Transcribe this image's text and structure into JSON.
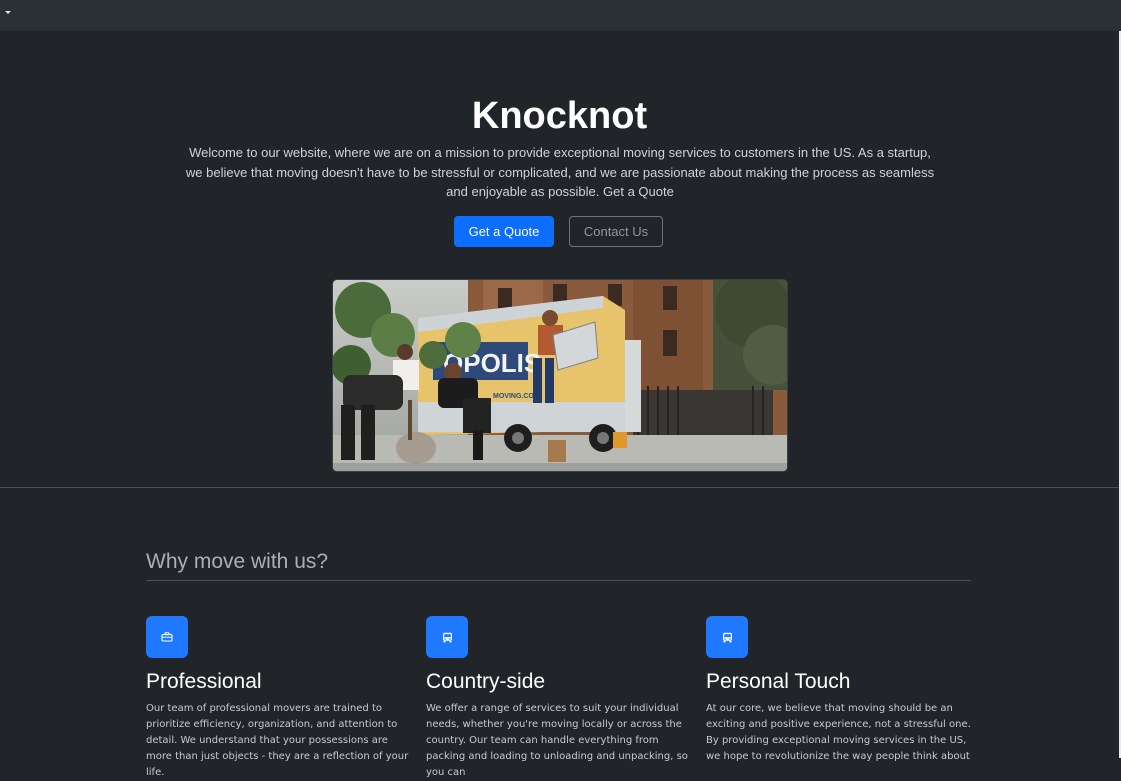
{
  "hero": {
    "title": "Knocknot",
    "intro": "Welcome to our website, where we are on a mission to provide exceptional moving services to customers in the US. As a startup, we believe that moving doesn't have to be stressful or complicated, and we are passionate about making the process as seamless and enjoyable as possible. Get a Quote",
    "primary_button": "Get a Quote",
    "secondary_button": "Contact Us",
    "image_truck_text": "OPOLIS",
    "image_truck_url_text": "MOVING.COM"
  },
  "why": {
    "title": "Why move with us?",
    "features": [
      {
        "icon": "briefcase-icon",
        "title": "Professional",
        "text": "Our team of professional movers are trained to prioritize efficiency, organization, and attention to detail. We understand that your possessions are more than just objects - they are a reflection of your life."
      },
      {
        "icon": "bus-icon",
        "title": "Country-side",
        "text": "We offer a range of services to suit your individual needs, whether you're moving locally or across the country. Our team can handle everything from packing and loading to unloading and unpacking, so you can"
      },
      {
        "icon": "bus-icon",
        "title": "Personal Touch",
        "text": "At our core, we believe that moving should be an exciting and positive experience, not a stressful one. By providing exceptional moving services in the US, we hope to revolutionize the way people think about"
      }
    ]
  },
  "colors": {
    "page_bg": "#212529",
    "topbar_bg": "#2b3035",
    "primary": "#0d6efd",
    "icon_box": "#1f79ff"
  }
}
